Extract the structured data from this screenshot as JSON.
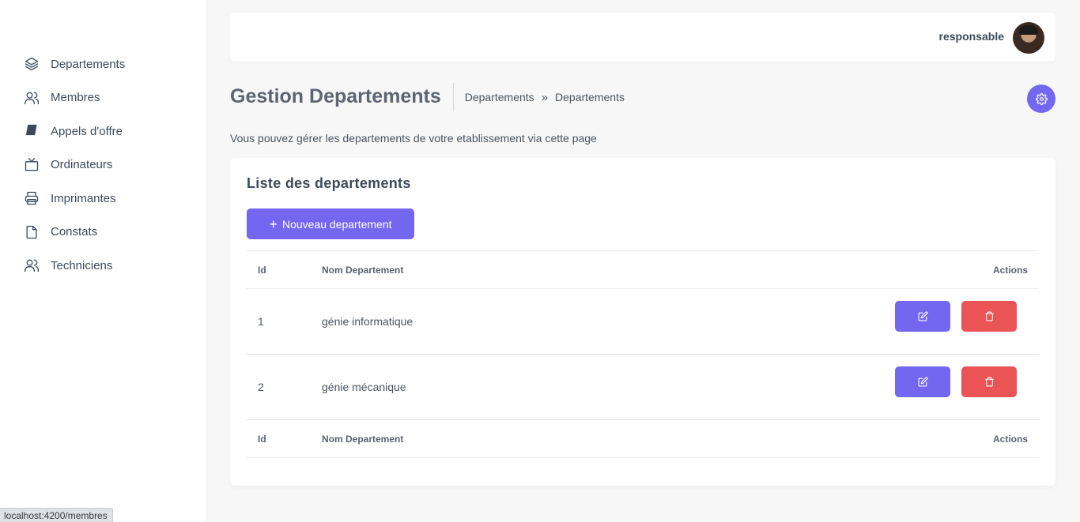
{
  "sidebar": {
    "items": [
      {
        "label": "Departements",
        "icon": "layers-icon"
      },
      {
        "label": "Membres",
        "icon": "users-icon"
      },
      {
        "label": "Appels d'offre",
        "icon": "book-icon"
      },
      {
        "label": "Ordinateurs",
        "icon": "tv-icon"
      },
      {
        "label": "Imprimantes",
        "icon": "printer-icon"
      },
      {
        "label": "Constats",
        "icon": "file-icon"
      },
      {
        "label": "Techniciens",
        "icon": "users-icon"
      }
    ]
  },
  "status_bar": {
    "url": "localhost:4200/membres"
  },
  "topbar": {
    "user_name": "responsable",
    "avatar": "user-avatar"
  },
  "header": {
    "title": "Gestion Departements",
    "breadcrumb": [
      "Departements",
      "Departements"
    ],
    "breadcrumb_separator": "»",
    "settings_icon": "gear-icon"
  },
  "description": "Vous pouvez gérer les departements de votre etablissement via cette page",
  "card": {
    "title": "Liste des departements",
    "new_button_label": "Nouveau departement",
    "new_button_icon": "+",
    "table": {
      "columns": [
        "Id",
        "Nom Departement",
        "Actions"
      ],
      "rows": [
        {
          "id": "1",
          "name": "génie informatique"
        },
        {
          "id": "2",
          "name": "génie mécanique"
        }
      ],
      "footer": [
        "Id",
        "Nom Departement",
        "Actions"
      ]
    }
  },
  "colors": {
    "primary": "#7367f0",
    "danger": "#ea5455",
    "background": "#f7f7f7"
  }
}
